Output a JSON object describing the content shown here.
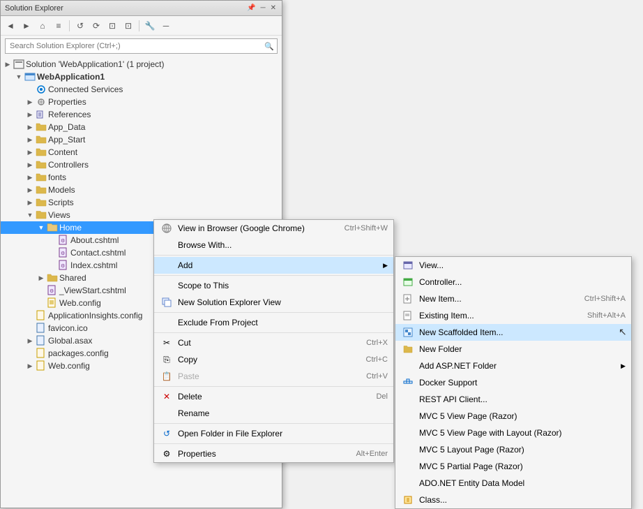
{
  "window": {
    "title": "Solution Explorer",
    "title_buttons": [
      "─",
      "□",
      "✕"
    ]
  },
  "toolbar": {
    "buttons": [
      "←",
      "→",
      "⌂",
      "≡",
      "↺",
      "⟳",
      "⊡",
      "⊡",
      "🔧",
      "─"
    ]
  },
  "search": {
    "placeholder": "Search Solution Explorer (Ctrl+;)",
    "icon": "🔍"
  },
  "tree": {
    "items": [
      {
        "id": "solution",
        "label": "Solution 'WebApplication1' (1 project)",
        "indent": 0,
        "expand": "collapsed",
        "icon": "solution"
      },
      {
        "id": "project",
        "label": "WebApplication1",
        "indent": 1,
        "expand": "expanded",
        "icon": "project",
        "bold": true
      },
      {
        "id": "connected",
        "label": "Connected Services",
        "indent": 2,
        "expand": "leaf",
        "icon": "service"
      },
      {
        "id": "properties",
        "label": "Properties",
        "indent": 2,
        "expand": "collapsed",
        "icon": "gear"
      },
      {
        "id": "references",
        "label": "References",
        "indent": 2,
        "expand": "collapsed",
        "icon": "ref"
      },
      {
        "id": "app_data",
        "label": "App_Data",
        "indent": 2,
        "expand": "collapsed",
        "icon": "folder"
      },
      {
        "id": "app_start",
        "label": "App_Start",
        "indent": 2,
        "expand": "collapsed",
        "icon": "folder"
      },
      {
        "id": "content",
        "label": "Content",
        "indent": 2,
        "expand": "collapsed",
        "icon": "folder"
      },
      {
        "id": "controllers",
        "label": "Controllers",
        "indent": 2,
        "expand": "collapsed",
        "icon": "folder"
      },
      {
        "id": "fonts",
        "label": "fonts",
        "indent": 2,
        "expand": "collapsed",
        "icon": "folder"
      },
      {
        "id": "models",
        "label": "Models",
        "indent": 2,
        "expand": "collapsed",
        "icon": "folder"
      },
      {
        "id": "scripts",
        "label": "Scripts",
        "indent": 2,
        "expand": "collapsed",
        "icon": "folder"
      },
      {
        "id": "views",
        "label": "Views",
        "indent": 2,
        "expand": "expanded",
        "icon": "folder"
      },
      {
        "id": "home",
        "label": "Home",
        "indent": 3,
        "expand": "expanded",
        "icon": "folder",
        "selected": true
      },
      {
        "id": "about",
        "label": "About.cshtml",
        "indent": 4,
        "expand": "leaf",
        "icon": "cshtml"
      },
      {
        "id": "contact",
        "label": "Contact.cshtml",
        "indent": 4,
        "expand": "leaf",
        "icon": "cshtml"
      },
      {
        "id": "index",
        "label": "Index.cshtml",
        "indent": 4,
        "expand": "leaf",
        "icon": "cshtml"
      },
      {
        "id": "shared",
        "label": "Shared",
        "indent": 3,
        "expand": "collapsed",
        "icon": "folder"
      },
      {
        "id": "viewstart",
        "label": "_ViewStart.cshtml",
        "indent": 3,
        "expand": "leaf",
        "icon": "cshtml"
      },
      {
        "id": "webconfig_views",
        "label": "Web.config",
        "indent": 3,
        "expand": "leaf",
        "icon": "config"
      },
      {
        "id": "appinsights",
        "label": "ApplicationInsights.config",
        "indent": 2,
        "expand": "leaf",
        "icon": "config"
      },
      {
        "id": "favicon",
        "label": "favicon.ico",
        "indent": 2,
        "expand": "leaf",
        "icon": "file"
      },
      {
        "id": "global",
        "label": "Global.asax",
        "indent": 2,
        "expand": "collapsed",
        "icon": "file"
      },
      {
        "id": "packages",
        "label": "packages.config",
        "indent": 2,
        "expand": "leaf",
        "icon": "config"
      },
      {
        "id": "webconfig",
        "label": "Web.config",
        "indent": 2,
        "expand": "collapsed",
        "icon": "config"
      }
    ]
  },
  "context_menu": {
    "items": [
      {
        "id": "view-browser",
        "label": "View in Browser (Google Chrome)",
        "shortcut": "Ctrl+Shift+W",
        "icon": "browser",
        "separator_after": false
      },
      {
        "id": "browse-with",
        "label": "Browse With...",
        "icon": "",
        "separator_after": true
      },
      {
        "id": "add",
        "label": "Add",
        "icon": "",
        "has_submenu": true,
        "separator_after": true
      },
      {
        "id": "scope",
        "label": "Scope to This",
        "icon": "",
        "separator_after": false
      },
      {
        "id": "new-explorer",
        "label": "New Solution Explorer View",
        "icon": "explorer",
        "separator_after": true
      },
      {
        "id": "exclude",
        "label": "Exclude From Project",
        "icon": "",
        "separator_after": true
      },
      {
        "id": "cut",
        "label": "Cut",
        "shortcut": "Ctrl+X",
        "icon": "cut",
        "separator_after": false
      },
      {
        "id": "copy",
        "label": "Copy",
        "shortcut": "Ctrl+C",
        "icon": "copy",
        "separator_after": false
      },
      {
        "id": "paste",
        "label": "Paste",
        "shortcut": "Ctrl+V",
        "icon": "paste",
        "disabled": true,
        "separator_after": true
      },
      {
        "id": "delete",
        "label": "Delete",
        "shortcut": "Del",
        "icon": "delete",
        "separator_after": false
      },
      {
        "id": "rename",
        "label": "Rename",
        "icon": "",
        "separator_after": true
      },
      {
        "id": "open-folder",
        "label": "Open Folder in File Explorer",
        "icon": "folder",
        "separator_after": true
      },
      {
        "id": "properties",
        "label": "Properties",
        "shortcut": "Alt+Enter",
        "icon": "gear",
        "separator_after": false
      }
    ]
  },
  "submenu": {
    "items": [
      {
        "id": "view",
        "label": "View...",
        "icon": "view",
        "separator_after": false
      },
      {
        "id": "controller",
        "label": "Controller...",
        "icon": "controller",
        "separator_after": false
      },
      {
        "id": "new-item",
        "label": "New Item...",
        "shortcut": "Ctrl+Shift+A",
        "icon": "new-item",
        "separator_after": false
      },
      {
        "id": "existing-item",
        "label": "Existing Item...",
        "shortcut": "Shift+Alt+A",
        "icon": "existing-item",
        "separator_after": false
      },
      {
        "id": "new-scaffolded",
        "label": "New Scaffolded Item...",
        "icon": "scaffold",
        "separator_after": false,
        "highlighted": true
      },
      {
        "id": "new-folder",
        "label": "New Folder",
        "icon": "folder",
        "separator_after": false
      },
      {
        "id": "add-aspnet",
        "label": "Add ASP.NET Folder",
        "icon": "",
        "has_submenu": true,
        "separator_after": false
      },
      {
        "id": "docker",
        "label": "Docker Support",
        "icon": "docker",
        "separator_after": false
      },
      {
        "id": "rest-api",
        "label": "REST API Client...",
        "icon": "",
        "separator_after": false
      },
      {
        "id": "mvc5-view",
        "label": "MVC 5 View Page (Razor)",
        "icon": "",
        "separator_after": false
      },
      {
        "id": "mvc5-layout",
        "label": "MVC 5 View Page with Layout (Razor)",
        "icon": "",
        "separator_after": false
      },
      {
        "id": "mvc5-layout2",
        "label": "MVC 5 Layout Page (Razor)",
        "icon": "",
        "separator_after": false
      },
      {
        "id": "mvc5-partial",
        "label": "MVC 5 Partial Page (Razor)",
        "icon": "",
        "separator_after": false
      },
      {
        "id": "ado-model",
        "label": "ADO.NET Entity Data Model",
        "icon": "",
        "separator_after": false
      },
      {
        "id": "class",
        "label": "Class...",
        "icon": "class",
        "separator_after": false
      }
    ]
  }
}
